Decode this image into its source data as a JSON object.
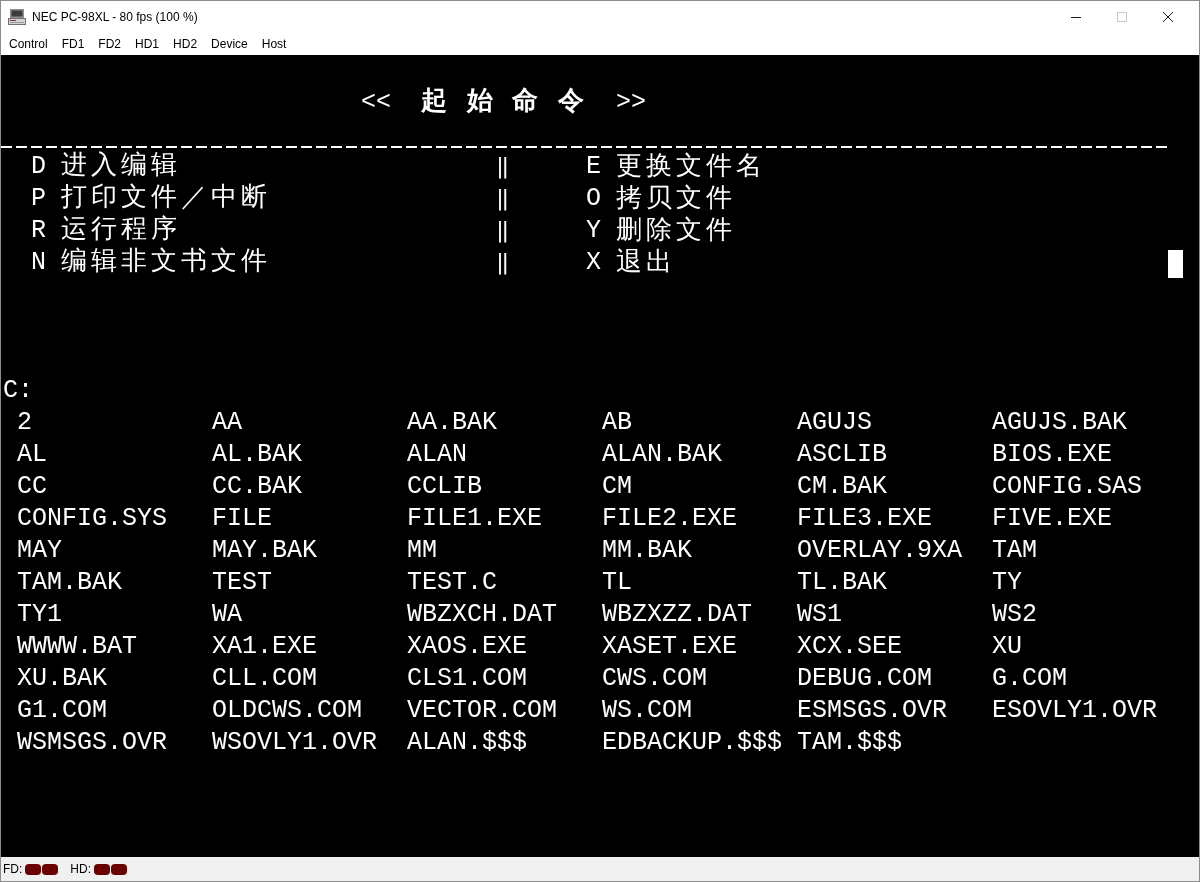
{
  "window": {
    "title": "NEC PC-98XL - 80 fps (100 %)",
    "controls": [
      {
        "kind": "minimize",
        "disabled": false
      },
      {
        "kind": "maximize",
        "disabled": true
      },
      {
        "kind": "close",
        "disabled": false
      }
    ]
  },
  "menu_bar": [
    "Control",
    "FD1",
    "FD2",
    "HD1",
    "HD2",
    "Device",
    "Host"
  ],
  "screen": {
    "heading": {
      "left": "<<",
      "text": "起 始 命 令",
      "right": ">>"
    },
    "commands": [
      {
        "left": {
          "key": "D",
          "label": "进入编辑"
        },
        "separator": "‖",
        "right": {
          "key": "E",
          "label": "更换文件名"
        }
      },
      {
        "left": {
          "key": "P",
          "label": "打印文件／中断"
        },
        "separator": "‖",
        "right": {
          "key": "O",
          "label": "拷贝文件"
        }
      },
      {
        "left": {
          "key": "R",
          "label": "运行程序"
        },
        "separator": "‖",
        "right": {
          "key": "Y",
          "label": "删除文件"
        }
      },
      {
        "left": {
          "key": "N",
          "label": "编辑非文书文件"
        },
        "separator": "‖",
        "right": {
          "key": "X",
          "label": "退出"
        }
      }
    ],
    "cursor_visible": true,
    "drive": "C:",
    "files": [
      "2",
      "AA",
      "AA.BAK",
      "AB",
      "AGUJS",
      "AGUJS.BAK",
      "AL",
      "AL.BAK",
      "ALAN",
      "ALAN.BAK",
      "ASCLIB",
      "BIOS.EXE",
      "CC",
      "CC.BAK",
      "CCLIB",
      "CM",
      "CM.BAK",
      "CONFIG.SAS",
      "CONFIG.SYS",
      "FILE",
      "FILE1.EXE",
      "FILE2.EXE",
      "FILE3.EXE",
      "FIVE.EXE",
      "MAY",
      "MAY.BAK",
      "MM",
      "MM.BAK",
      "OVERLAY.9XA",
      "TAM",
      "TAM.BAK",
      "TEST",
      "TEST.C",
      "TL",
      "TL.BAK",
      "TY",
      "TY1",
      "WA",
      "WBZXCH.DAT",
      "WBZXZZ.DAT",
      "WS1",
      "WS2",
      "WWWW.BAT",
      "XA1.EXE",
      "XAOS.EXE",
      "XASET.EXE",
      "XCX.SEE",
      "XU",
      "XU.BAK",
      "CLL.COM",
      "CLS1.COM",
      "CWS.COM",
      "DEBUG.COM",
      "G.COM",
      "G1.COM",
      "OLDCWS.COM",
      "VECTOR.COM",
      "WS.COM",
      "ESMSGS.OVR",
      "ESOVLY1.OVR",
      "WSMSGS.OVR",
      "WSOVLY1.OVR",
      "ALAN.$$$",
      "EDBACKUP.$$$",
      "TAM.$$$"
    ]
  },
  "status_bar": {
    "drives": [
      {
        "label": "FD:",
        "lamps": [
          {
            "lit": false
          },
          {
            "lit": false
          }
        ]
      },
      {
        "label": "HD:",
        "lamps": [
          {
            "lit": false
          },
          {
            "lit": false
          }
        ]
      }
    ]
  }
}
